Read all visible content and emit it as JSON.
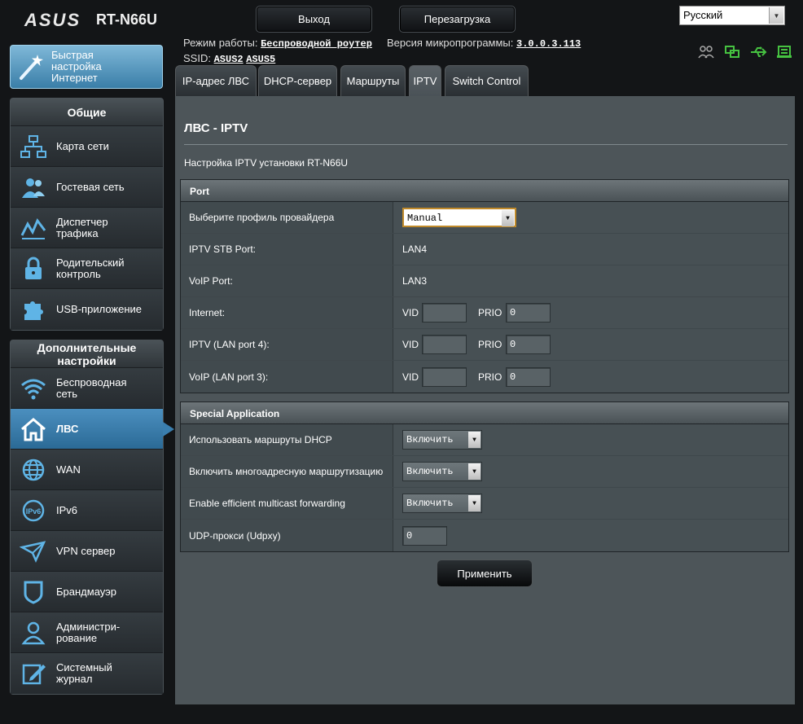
{
  "header": {
    "brand": "ASUS",
    "model": "RT-N66U",
    "logout_label": "Выход",
    "reboot_label": "Перезагрузка",
    "language": "Русский"
  },
  "status": {
    "mode_label": "Режим работы:",
    "mode_value": "Беспроводной роутер",
    "fw_label": "Версия микропрограммы:",
    "fw_value": "3.0.0.3.113",
    "ssid_label": "SSID:",
    "ssid1": "ASUS2",
    "ssid2": "ASUS5"
  },
  "quick_setup": "Быстрая настройка Интернет",
  "sidebar": {
    "general_title": "Общие",
    "general_items": [
      {
        "label": "Карта сети",
        "icon": "network-map-icon"
      },
      {
        "label": "Гостевая сеть",
        "icon": "guest-network-icon"
      },
      {
        "label": "Диспетчер трафика",
        "icon": "traffic-manager-icon"
      },
      {
        "label": "Родительский контроль",
        "icon": "parental-lock-icon"
      },
      {
        "label": "USB-приложение",
        "icon": "puzzle-icon"
      }
    ],
    "advanced_title": "Дополнительные настройки",
    "advanced_items": [
      {
        "label": "Беспроводная сеть",
        "icon": "wifi-icon"
      },
      {
        "label": "ЛВС",
        "icon": "home-icon"
      },
      {
        "label": "WAN",
        "icon": "globe-icon"
      },
      {
        "label": "IPv6",
        "icon": "ipv6-icon"
      },
      {
        "label": "VPN сервер",
        "icon": "vpn-icon"
      },
      {
        "label": "Брандмауэр",
        "icon": "shield-icon"
      },
      {
        "label": "Администри- рование",
        "icon": "admin-user-icon"
      },
      {
        "label": "Системный журнал",
        "icon": "log-pencil-icon"
      }
    ]
  },
  "tabs": [
    "IP-адрес ЛВС",
    "DHCP-сервер",
    "Маршруты",
    "IPTV",
    "Switch Control"
  ],
  "page": {
    "title": "ЛВС - IPTV",
    "description": "Настройка IPTV установки RT-N66U"
  },
  "port": {
    "header": "Port",
    "profile_label": "Выберите профиль провайдера",
    "profile_value": "Manual",
    "stb_label": "IPTV STB Port:",
    "stb_value": "LAN4",
    "voip_label": "VoIP Port:",
    "voip_value": "LAN3",
    "vid_label": "VID",
    "prio_label": "PRIO",
    "rows": [
      {
        "label": "Internet:",
        "vid": "",
        "prio": "0"
      },
      {
        "label": "IPTV (LAN port 4):",
        "vid": "",
        "prio": "0"
      },
      {
        "label": "VoIP (LAN port 3):",
        "vid": "",
        "prio": "0"
      }
    ]
  },
  "special": {
    "header": "Special Application",
    "rows": [
      {
        "label": "Использовать маршруты DHCP",
        "value": "Включить"
      },
      {
        "label": "Включить многоадресную маршрутизацию",
        "value": "Включить"
      },
      {
        "label": "Enable efficient multicast forwarding",
        "value": "Включить"
      }
    ],
    "udp_label": "UDP-прокси (Udpxy)",
    "udp_value": "0"
  },
  "apply_label": "Применить",
  "colors": {
    "accent": "#3a7eae",
    "panel": "#4d5559",
    "background": "#131517"
  }
}
